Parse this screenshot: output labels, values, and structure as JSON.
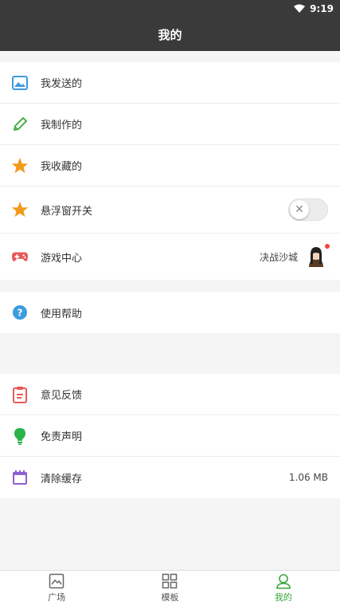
{
  "status_bar": {
    "time": "9:19"
  },
  "header": {
    "title": "我的"
  },
  "section1": {
    "items": [
      {
        "label": "我发送的",
        "icon": "image-icon",
        "color": "#3d9be0"
      },
      {
        "label": "我制作的",
        "icon": "pencil-icon",
        "color": "#4bb14b"
      },
      {
        "label": "我收藏的",
        "icon": "star-icon",
        "color": "#f29a1a"
      },
      {
        "label": "悬浮窗开关",
        "icon": "star-icon",
        "color": "#f29a1a",
        "toggle": false
      },
      {
        "label": "游戏中心",
        "icon": "gamepad-icon",
        "color": "#e65a5a",
        "value": "决战沙城"
      }
    ]
  },
  "section2": {
    "items": [
      {
        "label": "使用帮助",
        "icon": "help-icon",
        "color": "#3d9be0"
      }
    ]
  },
  "section3": {
    "items": [
      {
        "label": "意见反馈",
        "icon": "clipboard-icon",
        "color": "#e65a5a"
      },
      {
        "label": "免责声明",
        "icon": "bulb-icon",
        "color": "#2bb34a"
      },
      {
        "label": "清除缓存",
        "icon": "calendar-icon",
        "color": "#8e5fd3",
        "value": "1.06 MB"
      }
    ]
  },
  "tabbar": {
    "tabs": [
      {
        "label": "广场",
        "icon": "image-icon"
      },
      {
        "label": "模板",
        "icon": "grid-icon"
      },
      {
        "label": "我的",
        "icon": "user-icon",
        "active": true
      }
    ],
    "active_color": "#3aa63a"
  }
}
